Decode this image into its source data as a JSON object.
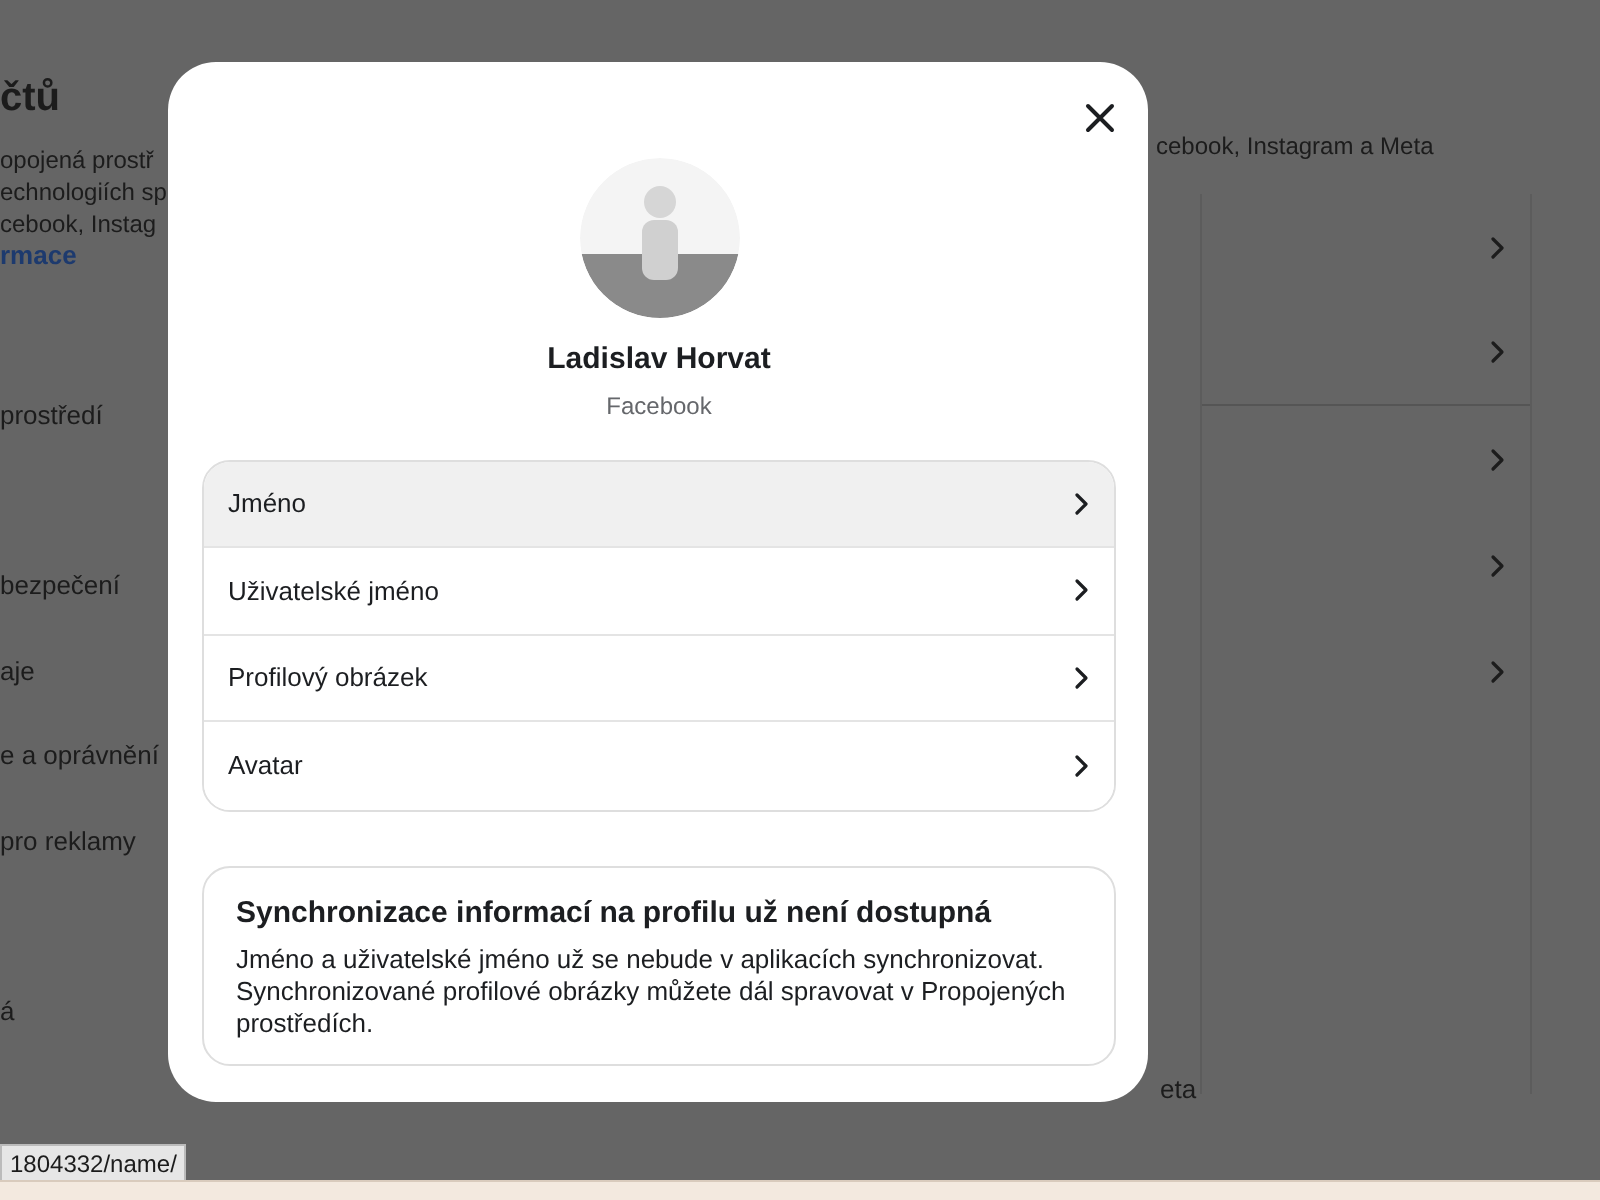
{
  "background": {
    "title": "čtů",
    "description_lines": [
      "opojená prostř",
      "echnologiích sp",
      "cebook, Instag"
    ],
    "link": "rmace",
    "nav_items": [
      "prostředí",
      "bezpečení",
      "aje",
      "e a oprávnění",
      "pro reklamy",
      "á"
    ],
    "right_text": "cebook, Instagram a Meta",
    "bottom_text": "eta"
  },
  "status_url": "1804332/name/",
  "dialog": {
    "profile": {
      "name": "Ladislav Horvat",
      "platform": "Facebook"
    },
    "items": [
      {
        "label": "Jméno",
        "selected": true
      },
      {
        "label": "Uživatelské jméno",
        "selected": false
      },
      {
        "label": "Profilový obrázek",
        "selected": false
      },
      {
        "label": "Avatar",
        "selected": false
      }
    ],
    "notice": {
      "title": "Synchronizace informací na profilu už není dostupná",
      "body": "Jméno a uživatelské jméno už se nebude v aplikacích synchronizovat. Synchronizované profilové obrázky můžete dál spravovat v Propojených prostředích."
    }
  }
}
